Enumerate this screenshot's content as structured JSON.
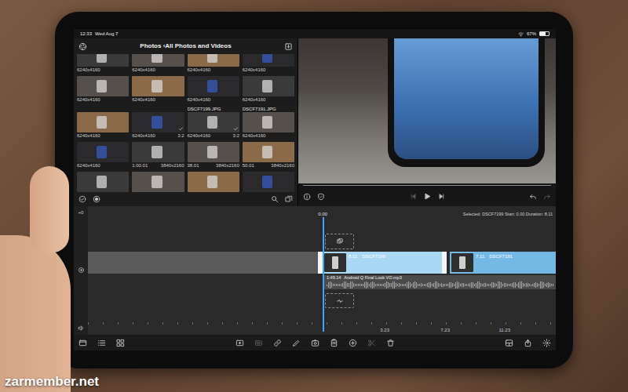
{
  "status_bar": {
    "time": "12:33",
    "date": "Wed Aug 7",
    "battery": "67%",
    "battery_level": 0.67
  },
  "library": {
    "title": "Photos ‹All Photos and Videos",
    "rows": [
      [
        {
          "caption": "6240x4160",
          "used": false
        },
        {
          "caption": "6240x4160",
          "used": false
        },
        {
          "caption": "6240x4160",
          "used": false
        },
        {
          "caption": "6240x4160",
          "used": false
        }
      ],
      [
        {
          "caption": "6240x4160",
          "used": false
        },
        {
          "caption": "6240x4160",
          "used": false
        },
        {
          "caption": "6240x4160",
          "used": false
        },
        {
          "caption": "6240x4160",
          "used": false
        }
      ],
      [
        {
          "caption": "6240x4160",
          "used": false
        },
        {
          "caption": "6240x4160",
          "detail": "3:2",
          "used": true
        },
        {
          "title": "DSCF7199.JPG",
          "caption": "6240x4160",
          "detail": "3:2",
          "used": true
        },
        {
          "title": "DSCF7191.JPG",
          "caption": "6240x4160",
          "used": false
        }
      ],
      [
        {
          "caption": "6240x4160",
          "used": false
        },
        {
          "caption": "1:00.01",
          "detail": "3840x2160",
          "used": false
        },
        {
          "caption": "38.01",
          "detail": "3840x2160",
          "used": false
        },
        {
          "caption": "50.01",
          "detail": "3840x2160",
          "used": false
        }
      ],
      [
        {
          "used": false
        },
        {
          "used": false
        },
        {
          "used": false
        },
        {
          "used": false
        }
      ]
    ]
  },
  "timeline": {
    "offset": "+0",
    "playhead": "0.00",
    "selection": "Selected: DSCF7199 Start: 0.00 Duration: 8.11",
    "clips": [
      {
        "duration": "8.11",
        "name": "DSCF7199",
        "selected": true
      },
      {
        "duration": "7.11",
        "name": "DSCF7191",
        "selected": false
      }
    ],
    "audio": {
      "duration": "1:49.14",
      "name": "Android Q Final Look VO.mp3"
    },
    "ruler": [
      "3.23",
      "7.23",
      "11.23"
    ]
  },
  "watermark": "zarmember.net"
}
